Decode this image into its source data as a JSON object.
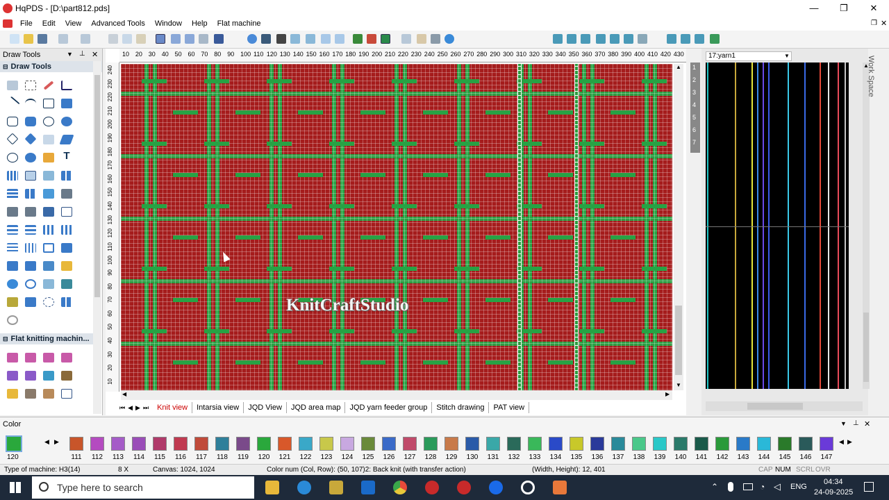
{
  "titlebar": {
    "title": "HqPDS - [D:\\part812.pds]",
    "minimize": "—",
    "restore": "❐",
    "close": "✕"
  },
  "menu": [
    "File",
    "Edit",
    "View",
    "Advanced Tools",
    "Window",
    "Help",
    "Flat machine"
  ],
  "left_panel": {
    "title": "Draw Tools",
    "section1": "Draw Tools",
    "section2": "Flat knitting machin..."
  },
  "ruler_top": [
    "10",
    "20",
    "30",
    "40",
    "50",
    "60",
    "70",
    "80",
    "90",
    "100",
    "110",
    "120",
    "130",
    "140",
    "150",
    "160",
    "170",
    "180",
    "190",
    "200",
    "210",
    "220",
    "230",
    "240",
    "250",
    "260",
    "270",
    "280",
    "290",
    "300",
    "310",
    "320",
    "330",
    "340",
    "350",
    "360",
    "370",
    "380",
    "390",
    "400",
    "410",
    "420",
    "430"
  ],
  "ruler_left": [
    "240",
    "230",
    "220",
    "210",
    "200",
    "190",
    "180",
    "170",
    "160",
    "150",
    "140",
    "130",
    "120",
    "110",
    "100",
    "90",
    "80",
    "70",
    "60",
    "50",
    "40",
    "30",
    "20",
    "10"
  ],
  "watermark": "KnitCraftStudio",
  "tabs": [
    "Knit view",
    "Intarsia view",
    "JQD View",
    "JQD area map",
    "JQD yarn feeder group",
    "Stitch drawing",
    "PAT view"
  ],
  "right_panel": {
    "dropdown": "17:yarn1",
    "side_label": "Work Space",
    "rows": [
      "1",
      "2",
      "3",
      "4",
      "5",
      "6",
      "7"
    ]
  },
  "color_panel": {
    "title": "Color",
    "current": "120",
    "swatches": [
      {
        "n": "111",
        "c": "#c8552a"
      },
      {
        "n": "112",
        "c": "#b44bc0"
      },
      {
        "n": "113",
        "c": "#a55cc8"
      },
      {
        "n": "114",
        "c": "#9a4db8"
      },
      {
        "n": "115",
        "c": "#b03a6a"
      },
      {
        "n": "116",
        "c": "#c03a50"
      },
      {
        "n": "117",
        "c": "#c04a3a"
      },
      {
        "n": "118",
        "c": "#2f7f9a"
      },
      {
        "n": "119",
        "c": "#7a4a8a"
      },
      {
        "n": "120",
        "c": "#2aa83c"
      },
      {
        "n": "121",
        "c": "#d8582a"
      },
      {
        "n": "122",
        "c": "#3aa8c8"
      },
      {
        "n": "123",
        "c": "#c8c84a"
      },
      {
        "n": "124",
        "c": "#c8a8e0"
      },
      {
        "n": "125",
        "c": "#6a8a3a"
      },
      {
        "n": "126",
        "c": "#3a6ac8"
      },
      {
        "n": "127",
        "c": "#c04a6a"
      },
      {
        "n": "128",
        "c": "#2a9a5a"
      },
      {
        "n": "129",
        "c": "#c87a4a"
      },
      {
        "n": "130",
        "c": "#2a5aa8"
      },
      {
        "n": "131",
        "c": "#3aa8a8"
      },
      {
        "n": "132",
        "c": "#2a6a5a"
      },
      {
        "n": "133",
        "c": "#3ab85a"
      },
      {
        "n": "134",
        "c": "#2a4ac8"
      },
      {
        "n": "135",
        "c": "#c8c82a"
      },
      {
        "n": "136",
        "c": "#2a3a9a"
      },
      {
        "n": "137",
        "c": "#2a8a9a"
      },
      {
        "n": "138",
        "c": "#4ac88a"
      },
      {
        "n": "139",
        "c": "#2ac8c8"
      },
      {
        "n": "140",
        "c": "#2a7a6a"
      },
      {
        "n": "141",
        "c": "#1a5a4a"
      },
      {
        "n": "142",
        "c": "#2a9a3a"
      },
      {
        "n": "143",
        "c": "#2a7ac8"
      },
      {
        "n": "144",
        "c": "#2ab8d8"
      },
      {
        "n": "145",
        "c": "#2a7a2a"
      },
      {
        "n": "146",
        "c": "#2a5a5a"
      },
      {
        "n": "147",
        "c": "#6a3ad8"
      }
    ]
  },
  "status": {
    "machine": "Type of machine: H3(14)",
    "zoom": "8 X",
    "canvas": "Canvas: 1024, 1024",
    "colornum": "Color num (Col, Row): (50, 107)2: Back knit (with transfer action)",
    "size": "(Width, Height): 12, 401",
    "caps": "CAP",
    "num": "NUM",
    "scrl": "SCRL",
    "ovr": "OVR"
  },
  "taskbar": {
    "search": "Type here to search",
    "lang": "ENG",
    "time": "04:34",
    "date": "24-09-2025"
  }
}
